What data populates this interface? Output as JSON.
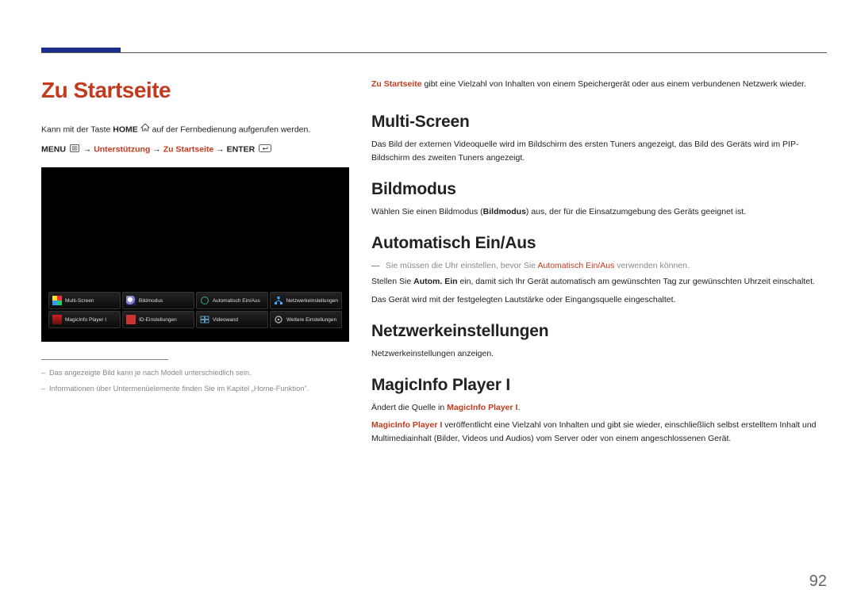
{
  "page_number": "92",
  "left": {
    "title": "Zu Startseite",
    "intro_before": "Kann mit der Taste ",
    "intro_home": "HOME",
    "intro_after": " auf der Fernbedienung aufgerufen werden.",
    "menu_path": {
      "menu": "MENU",
      "p1": "Unterstützung",
      "p2": "Zu Startseite",
      "enter": "ENTER"
    },
    "tiles_row1": [
      "Multi-Screen",
      "Bildmodus",
      "Automatisch Ein/Aus",
      "Netzwerkeinstellungen"
    ],
    "tiles_row2": [
      "MagicInfo Player I",
      "ID-Einstellungen",
      "Videowand",
      "Weitere Einstellungen"
    ],
    "footnote1": "Das angezeigte Bild kann je nach Modell unterschiedlich sein.",
    "footnote2": "Informationen über Untermenüelemente finden Sie im Kapitel „Home-Funktion\"."
  },
  "right": {
    "lead_before": "",
    "lead_red": "Zu Startseite",
    "lead_after": " gibt eine Vielzahl von Inhalten von einem Speichergerät oder aus einem verbundenen Netzwerk wieder.",
    "sections": {
      "multiscreen": {
        "title": "Multi-Screen",
        "text": "Das Bild der externen Videoquelle wird im Bildschirm des ersten Tuners angezeigt, das Bild des Geräts wird im PIP-Bildschirm des zweiten Tuners angezeigt."
      },
      "bildmodus": {
        "title": "Bildmodus",
        "text_before": "Wählen Sie einen Bildmodus (",
        "text_bold": "Bildmodus",
        "text_after": ") aus, der für die Einsatzumgebung des Geräts geeignet ist."
      },
      "auto": {
        "title": "Automatisch Ein/Aus",
        "note_before": "Sie müssen die Uhr einstellen, bevor Sie ",
        "note_bold": "Automatisch Ein/Aus",
        "note_after": " verwenden können.",
        "line1_before": "Stellen Sie ",
        "line1_bold": "Autom. Ein",
        "line1_after": " ein, damit sich Ihr Gerät automatisch am gewünschten Tag zur gewünschten Uhrzeit einschaltet.",
        "line2": "Das Gerät wird mit der festgelegten Lautstärke oder Eingangsquelle eingeschaltet."
      },
      "netz": {
        "title": "Netzwerkeinstellungen",
        "text": "Netzwerkeinstellungen anzeigen."
      },
      "magicinfo": {
        "title": "MagicInfo Player I",
        "line1_before": "Ändert die Quelle in ",
        "line1_red": "MagicInfo Player I",
        "line1_after": ".",
        "line2_red": "MagicInfo Player I",
        "line2_after": " veröffentlicht eine Vielzahl von Inhalten und gibt sie wieder, einschließlich selbst erstelltem Inhalt und Multimediainhalt (Bilder, Videos und Audios) vom Server oder von einem angeschlossenen Gerät."
      }
    }
  }
}
